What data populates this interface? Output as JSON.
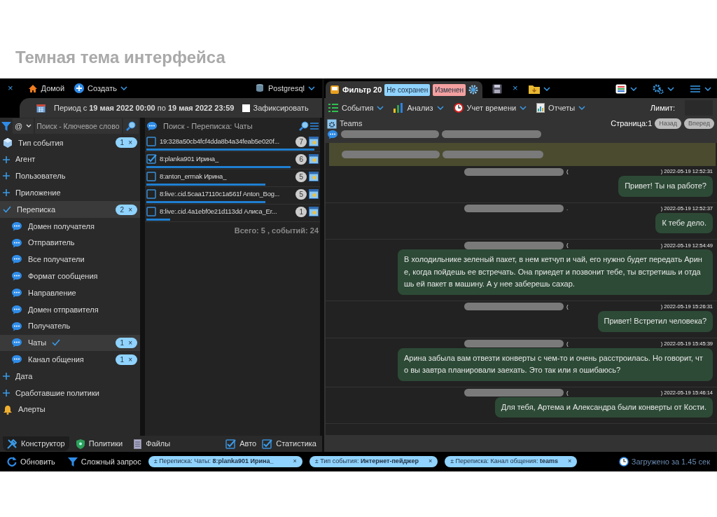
{
  "heading": "Темная тема интерфейса",
  "topbar": {
    "close": "×",
    "home": "Домой",
    "create": "Создать",
    "database": "Postgresql"
  },
  "period": {
    "text": "Период с **19 мая 2022 00:00** по **19 мая 2022 23:59**",
    "fix": {
      "label": "Зафиксировать",
      "checked": false
    }
  },
  "filter_search": {
    "prefix": "@",
    "placeholder": "Поиск - Ключевое слово"
  },
  "tree": [
    {
      "kind": "event-type",
      "label": "Тип события",
      "selected": false,
      "count": "1",
      "clear": "×"
    },
    {
      "kind": "group",
      "label": "Агент",
      "expanded": false,
      "selected": false
    },
    {
      "kind": "group",
      "label": "Пользователь",
      "expanded": false,
      "selected": false
    },
    {
      "kind": "group",
      "label": "Приложение",
      "expanded": false,
      "selected": false
    },
    {
      "kind": "group",
      "label": "Переписка",
      "expanded": true,
      "selected": true,
      "count": "2",
      "clear": "×",
      "children": [
        {
          "label": "Домен получателя",
          "selected": false
        },
        {
          "label": "Отправитель",
          "selected": false
        },
        {
          "label": "Все получатели",
          "selected": false
        },
        {
          "label": "Формат сообщения",
          "selected": false
        },
        {
          "label": "Направление",
          "selected": false
        },
        {
          "label": "Домен отправителя",
          "selected": false
        },
        {
          "label": "Получатель",
          "selected": false
        },
        {
          "label": "Чаты",
          "selected": true,
          "count": "1",
          "clear": "×"
        },
        {
          "label": "Канал общения",
          "selected": false,
          "count": "1",
          "clear": "×"
        }
      ]
    },
    {
      "kind": "group",
      "label": "Дата",
      "expanded": false,
      "selected": false
    },
    {
      "kind": "group",
      "label": "Сработавшие политики",
      "expanded": false,
      "selected": false
    },
    {
      "kind": "alerts",
      "label": "Алерты",
      "selected": false
    }
  ],
  "chat_search": {
    "placeholder": "Поиск - Переписка: Чаты"
  },
  "chats": [
    {
      "label": "19:328a50cb4fcf4dda8b4a34feab5e020f...",
      "checked": false,
      "count": "7",
      "level": 1.0
    },
    {
      "label": "8:planka901 Ирина_",
      "checked": true,
      "count": "6",
      "level": 0.86
    },
    {
      "label": "8:anton_ermak Ирина_",
      "checked": false,
      "count": "5",
      "level": 0.71
    },
    {
      "label": "8:live:.cid.5caa17110c1a561f Anton_Bog...",
      "checked": false,
      "count": "5",
      "level": 0.71
    },
    {
      "label": "8:live:.cid.4a1ebf0e21d113dd Алиса_Er...",
      "checked": false,
      "count": "1",
      "level": 0.14
    }
  ],
  "chat_total": "Всего: 5 , событий: 24",
  "bottom_tabs": [
    {
      "label": "Конструктор",
      "kind": "tools",
      "selected": true
    },
    {
      "label": "Политики",
      "kind": "shield",
      "selected": false
    },
    {
      "label": "Файлы",
      "kind": "file",
      "selected": false
    }
  ],
  "bottom_checks": [
    {
      "label": "Авто",
      "checked": true
    },
    {
      "label": "Статистика",
      "checked": true
    }
  ],
  "filter_tab": {
    "title": "Фильтр 20",
    "badges": [
      {
        "text": "Не сохранен",
        "color": "#8fd3fe"
      },
      {
        "text": "Изменен",
        "color": "#f4a0a0"
      }
    ],
    "close": "×"
  },
  "toolbar": [
    {
      "label": "События",
      "kind": "list"
    },
    {
      "label": "Анализ",
      "kind": "bars"
    },
    {
      "label": "Учет времени",
      "kind": "clock"
    },
    {
      "label": "Отчеты",
      "kind": "report"
    }
  ],
  "limit": {
    "label": "Лимит:"
  },
  "source": {
    "name": "Teams",
    "page": "Страница:1",
    "prev": {
      "label": "Назад",
      "disabled": true
    },
    "next": {
      "label": "Вперед",
      "disabled": true
    }
  },
  "messages": [
    {
      "mark": "(",
      "time": ") 2022-05-19 12:52:31",
      "text": "Привет! Ты на работе?"
    },
    {
      "mark": ".",
      "time": ") 2022-05-19 12:52:37",
      "text": "К тебе дело."
    },
    {
      "mark": "(",
      "time": ") 2022-05-19 12:54:49",
      "text": "В холодильнике зеленый пакет, в нем кетчуп и чай, его нужно будет передать Арине, когда пойдешь ее встречать. Она приедет и позвонит тебе, ты встретишь и отдашь ей пакет в машину. А у нее заберешь сахар."
    },
    {
      "mark": "(",
      "time": ") 2022-05-19 15:26:31",
      "text": "Привет! Встретил человека?"
    },
    {
      "mark": "(",
      "time": ") 2022-05-19 15:45:39",
      "text": "Арина забыла вам отвезти конверты с чем-то и очень расстроилась. Но говорит, что вы завтра планировали заехать. Это так или я ошибаюсь?"
    },
    {
      "mark": "(",
      "time": ") 2022-05-19 15:46:14",
      "text": "Для тебя, Артема и Александра были конверты от Кости."
    }
  ],
  "statusbar": {
    "refresh": "Обновить",
    "query": "Сложный запрос",
    "chips": [
      {
        "text": "± Переписка: Чаты: **8:planka901 Ирина_**",
        "clear": "×"
      },
      {
        "text": "± Тип события: **Интернет-пейджер**",
        "clear": "×"
      },
      {
        "text": "± Переписка: Канал общения: **teams**",
        "clear": "×"
      }
    ],
    "loaded": "Загружено за 1.45 сек"
  }
}
